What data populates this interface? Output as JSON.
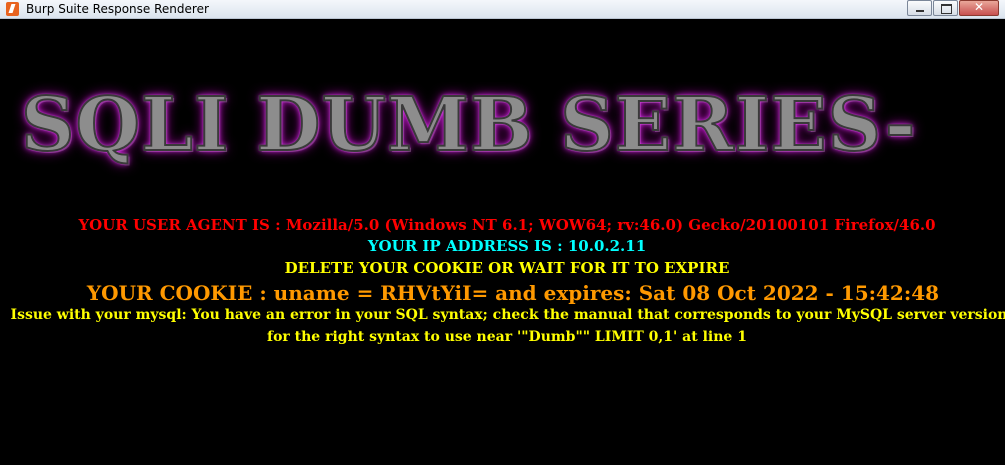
{
  "window": {
    "title": "Burp Suite Response Renderer",
    "minimize_icon": "minimize-icon",
    "maximize_icon": "maximize-icon",
    "close_icon": "close-icon",
    "close_glyph": "✕"
  },
  "page": {
    "banner": "SQLI DUMB SERIES-",
    "user_agent_line": "YOUR USER AGENT IS : Mozilla/5.0 (Windows NT 6.1; WOW64; rv:46.0) Gecko/20100101 Firefox/46.0",
    "ip_line": "YOUR IP ADDRESS IS : 10.0.2.11",
    "delete_cookie_line": "DELETE YOUR COOKIE OR WAIT FOR IT TO EXPIRE",
    "cookie_line": "YOUR COOKIE : uname = RHVtYiI= and expires: Sat 08 Oct 2022 - 15:42:48",
    "error_line_1": "Issue with your mysql: You have an error in your SQL syntax; check the manual that corresponds to your MySQL server version",
    "error_line_2": "for the right syntax to use near '\"Dumb\"\" LIMIT 0,1' at line 1"
  },
  "colors": {
    "background": "#000000",
    "user_agent": "#ff0000",
    "ip": "#00ffff",
    "notice": "#ffff00",
    "cookie": "#ff9900",
    "banner_glow": "#e040fb"
  }
}
